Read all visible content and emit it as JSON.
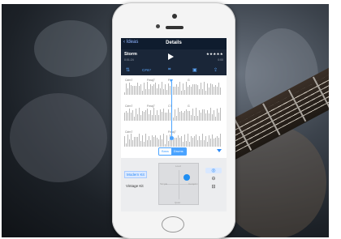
{
  "app": {
    "nav": {
      "back_label": "Ideas",
      "title": "Details"
    },
    "song": {
      "name": "Storm",
      "time": "0:01:24",
      "rating": "★★★★★",
      "bpm": "0:00"
    },
    "toolbar": {
      "key_label": "C#m⁷"
    },
    "chords": {
      "row1": [
        "C#m7",
        "Fmaj7",
        "F#",
        "G"
      ],
      "row2": [
        "C#m7",
        "Fmaj7",
        "C7",
        "G"
      ],
      "row3": [
        "C#m7",
        "Fmaj7"
      ]
    },
    "segment": {
      "options": [
        "Bass",
        "Drums"
      ],
      "selected": "Drums"
    },
    "kits": {
      "kit1": "Modern Kit",
      "kit2": "Vintage Kit"
    },
    "pad": {
      "top_label": "Loud",
      "bottom_label": "Quiet",
      "left_label": "Simple",
      "right_label": "Complex"
    },
    "icons": [
      "back-chevron-icon",
      "play-icon",
      "mixer-icon",
      "key-icon",
      "crop-icon",
      "notes-icon",
      "share-icon",
      "dropdown-arrow-icon",
      "cymbal-icon",
      "snare-icon",
      "kick-icon"
    ],
    "accent_color": "#2b8af7",
    "nav_color": "#0f1c2e"
  }
}
